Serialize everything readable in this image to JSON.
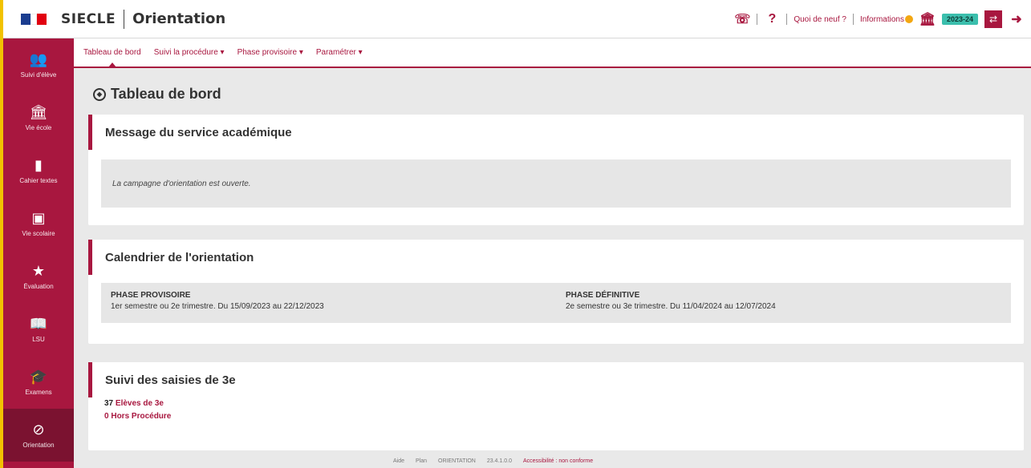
{
  "header": {
    "brand": "SIECLE",
    "module": "Orientation",
    "quoi_de_neuf": "Quoi de neuf ?",
    "informations": "Informations",
    "year": "2023-24"
  },
  "sidebar": {
    "items": [
      {
        "label": "Suivi d'élève",
        "icon": "users-icon"
      },
      {
        "label": "Vie école",
        "icon": "school-icon"
      },
      {
        "label": "Cahier textes",
        "icon": "book-icon"
      },
      {
        "label": "Vie scolaire",
        "icon": "calendar-icon"
      },
      {
        "label": "Évaluation",
        "icon": "star-icon"
      },
      {
        "label": "LSU",
        "icon": "open-book-icon"
      },
      {
        "label": "Examens",
        "icon": "exam-icon"
      },
      {
        "label": "Orientation",
        "icon": "compass-icon"
      }
    ]
  },
  "subnav": {
    "items": [
      "Tableau de bord",
      "Suivi la procédure ▾",
      "Phase provisoire ▾",
      "Paramétrer ▾"
    ]
  },
  "main": {
    "title": "Tableau de bord",
    "message_card": {
      "title": "Message du service académique",
      "text": "La campagne d'orientation est ouverte."
    },
    "calendar_card": {
      "title": "Calendrier de l'orientation",
      "phase1_title": "PHASE PROVISOIRE",
      "phase1_text": "1er semestre ou 2e trimestre. Du 15/09/2023 au 22/12/2023",
      "phase2_title": "PHASE DÉFINITIVE",
      "phase2_text": "2e semestre ou 3e trimestre. Du 11/04/2024 au 12/07/2024"
    },
    "suivi_card": {
      "title": "Suivi des saisies de 3e",
      "line1_count": "37",
      "line1_label": "Elèves de 3e",
      "line2_count": "0",
      "line2_label": "Hors Procédure"
    }
  },
  "footer": {
    "items": [
      "Aide",
      "Plan",
      "ORIENTATION",
      "23.4.1.0.0"
    ],
    "link": "Accessibilité : non conforme"
  },
  "colors": {
    "accent": "#a8173f",
    "accent_dark": "#7b1230",
    "year_badge": "#3bbfad"
  }
}
